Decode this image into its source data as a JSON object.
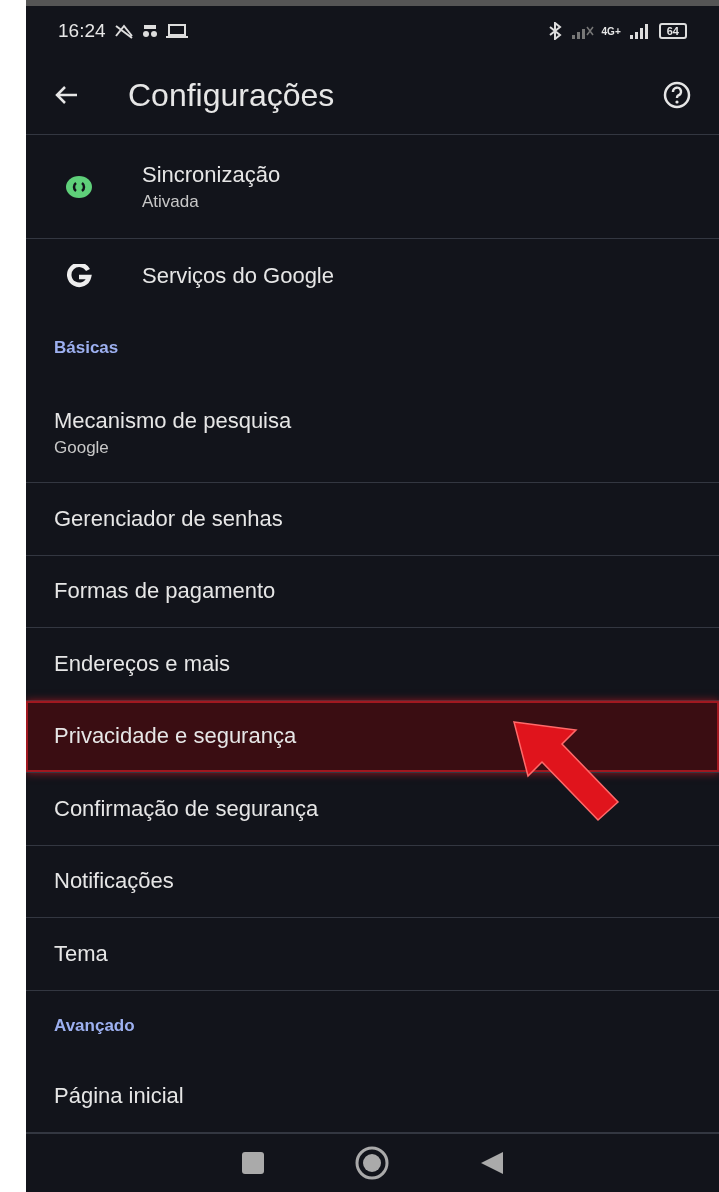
{
  "status_bar": {
    "time": "16:24",
    "battery": "64",
    "network": "4G+"
  },
  "toolbar": {
    "title": "Configurações"
  },
  "items": [
    {
      "kind": "sync",
      "title": "Sincronização",
      "subtitle": "Ativada",
      "highlighted": false
    },
    {
      "kind": "google",
      "title": "Serviços do Google",
      "highlighted": false
    },
    {
      "kind": "header",
      "title": "Básicas"
    },
    {
      "kind": "item",
      "title": "Mecanismo de pesquisa",
      "subtitle": "Google",
      "highlighted": false
    },
    {
      "kind": "item",
      "title": "Gerenciador de senhas",
      "highlighted": false
    },
    {
      "kind": "item",
      "title": "Formas de pagamento",
      "highlighted": false
    },
    {
      "kind": "item",
      "title": "Endereços e mais",
      "highlighted": false
    },
    {
      "kind": "item",
      "title": "Privacidade e segurança",
      "highlighted": true
    },
    {
      "kind": "item",
      "title": "Confirmação de segurança",
      "highlighted": false
    },
    {
      "kind": "item",
      "title": "Notificações",
      "highlighted": false
    },
    {
      "kind": "item",
      "title": "Tema",
      "highlighted": false
    },
    {
      "kind": "header",
      "title": "Avançado"
    },
    {
      "kind": "item",
      "title": "Página inicial",
      "highlighted": false
    }
  ]
}
